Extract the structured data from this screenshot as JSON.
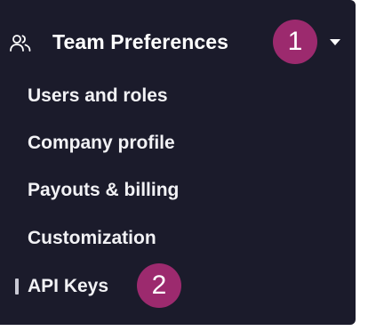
{
  "section": {
    "title": "Team Preferences",
    "icon": "users-icon",
    "expanded": true,
    "badge": "1"
  },
  "nav": {
    "items": [
      {
        "label": "Users and roles"
      },
      {
        "label": "Company profile"
      },
      {
        "label": "Payouts & billing"
      },
      {
        "label": "Customization"
      },
      {
        "label": "API Keys",
        "active": true,
        "badge": "2"
      }
    ]
  },
  "colors": {
    "panel_bg": "#1b1b2b",
    "badge_bg": "#9c2a6e",
    "text": "#ffffff"
  }
}
